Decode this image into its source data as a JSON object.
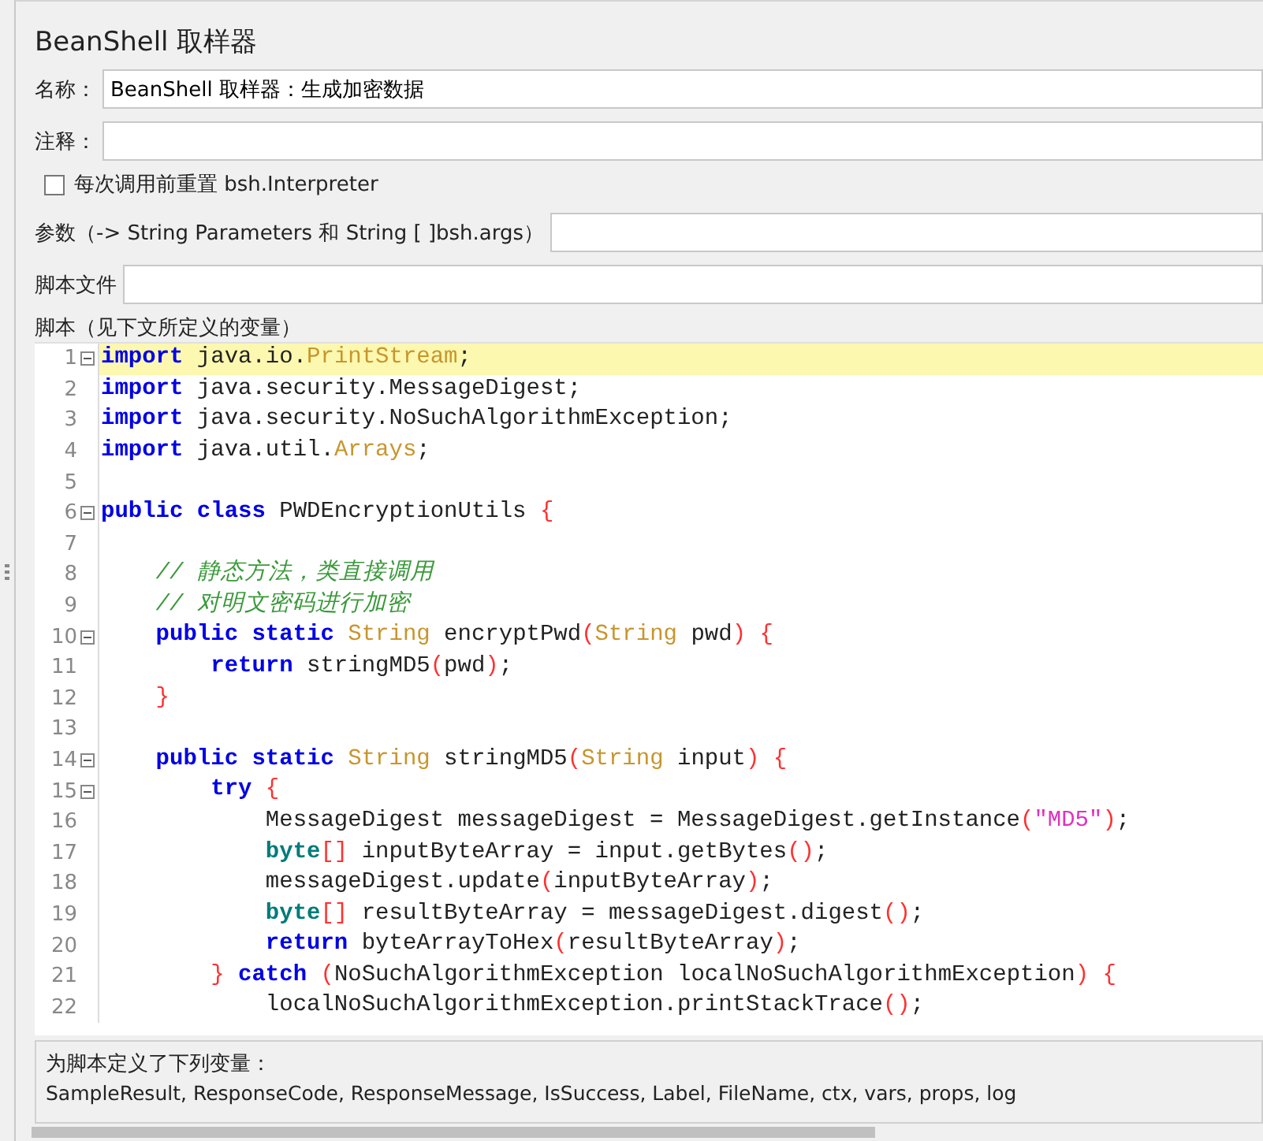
{
  "panel": {
    "title": "BeanShell 取样器"
  },
  "fields": [
    {
      "kind": "text",
      "label": "名称：",
      "value": "BeanShell 取样器：生成加密数据"
    },
    {
      "kind": "text",
      "label": "注释："
    },
    {
      "kind": "checkbox",
      "label": "每次调用前重置 bsh.Interpreter",
      "checked": false
    },
    {
      "kind": "text",
      "label": "参数（-> String Parameters 和 String [ ]bsh.args）"
    },
    {
      "kind": "text",
      "label": "脚本文件"
    }
  ],
  "script_label": "脚本（见下文所定义的变量）",
  "code": {
    "lines": [
      {
        "number": "1",
        "fold": true,
        "current": true,
        "tokens": [
          {
            "kind": "kw",
            "text": "import"
          },
          {
            "kind": "pl",
            "text": " java.io."
          },
          {
            "kind": "ty",
            "text": "PrintStream"
          },
          {
            "kind": "pl",
            "text": ";"
          }
        ]
      },
      {
        "number": "2",
        "fold": false,
        "current": false,
        "tokens": [
          {
            "kind": "kw",
            "text": "import"
          },
          {
            "kind": "pl",
            "text": " java.security.MessageDigest;"
          }
        ]
      },
      {
        "number": "3",
        "fold": false,
        "current": false,
        "tokens": [
          {
            "kind": "kw",
            "text": "import"
          },
          {
            "kind": "pl",
            "text": " java.security.NoSuchAlgorithmException;"
          }
        ]
      },
      {
        "number": "4",
        "fold": false,
        "current": false,
        "tokens": [
          {
            "kind": "kw",
            "text": "import"
          },
          {
            "kind": "pl",
            "text": " java.util."
          },
          {
            "kind": "ty",
            "text": "Arrays"
          },
          {
            "kind": "pl",
            "text": ";"
          }
        ]
      },
      {
        "number": "5",
        "fold": false,
        "current": false
      },
      {
        "number": "6",
        "fold": true,
        "current": false,
        "tokens": [
          {
            "kind": "kw",
            "text": "public class"
          },
          {
            "kind": "pl",
            "text": " PWDEncryptionUtils"
          },
          {
            "kind": "br",
            "text": " {"
          }
        ]
      },
      {
        "number": "7",
        "fold": false,
        "current": false
      },
      {
        "number": "8",
        "fold": false,
        "current": false,
        "tokens": [
          {
            "kind": "cm",
            "text": "    // 静态方法，类直接调用"
          }
        ]
      },
      {
        "number": "9",
        "fold": false,
        "current": false,
        "tokens": [
          {
            "kind": "cm",
            "text": "    // 对明文密码进行加密"
          }
        ]
      },
      {
        "number": "10",
        "fold": true,
        "current": false,
        "tokens": [
          {
            "kind": "kw",
            "text": "    public static"
          },
          {
            "kind": "ty",
            "text": " String"
          },
          {
            "kind": "pl",
            "text": " encryptPwd"
          },
          {
            "kind": "br",
            "text": "("
          },
          {
            "kind": "ty",
            "text": "String"
          },
          {
            "kind": "pl",
            "text": " pwd"
          },
          {
            "kind": "br",
            "text": ") {"
          }
        ]
      },
      {
        "number": "11",
        "fold": false,
        "current": false,
        "tokens": [
          {
            "kind": "kw",
            "text": "        return"
          },
          {
            "kind": "pl",
            "text": " stringMD5"
          },
          {
            "kind": "br",
            "text": "("
          },
          {
            "kind": "pl",
            "text": "pwd"
          },
          {
            "kind": "br",
            "text": ")"
          },
          {
            "kind": "pl",
            "text": ";"
          }
        ]
      },
      {
        "number": "12",
        "fold": false,
        "current": false,
        "tokens": [
          {
            "kind": "br",
            "text": "    }"
          }
        ]
      },
      {
        "number": "13",
        "fold": false,
        "current": false
      },
      {
        "number": "14",
        "fold": true,
        "current": false,
        "tokens": [
          {
            "kind": "kw",
            "text": "    public static"
          },
          {
            "kind": "ty",
            "text": " String"
          },
          {
            "kind": "pl",
            "text": " stringMD5"
          },
          {
            "kind": "br",
            "text": "("
          },
          {
            "kind": "ty",
            "text": "String"
          },
          {
            "kind": "pl",
            "text": " input"
          },
          {
            "kind": "br",
            "text": ") {"
          }
        ]
      },
      {
        "number": "15",
        "fold": true,
        "current": false,
        "tokens": [
          {
            "kind": "kw",
            "text": "        try"
          },
          {
            "kind": "br",
            "text": " {"
          }
        ]
      },
      {
        "number": "16",
        "fold": false,
        "current": false,
        "tokens": [
          {
            "kind": "pl",
            "text": "            MessageDigest messageDigest = MessageDigest.getInstance"
          },
          {
            "kind": "br",
            "text": "("
          },
          {
            "kind": "st",
            "text": "\"MD5\""
          },
          {
            "kind": "br",
            "text": ")"
          },
          {
            "kind": "pl",
            "text": ";"
          }
        ]
      },
      {
        "number": "17",
        "fold": false,
        "current": false,
        "tokens": [
          {
            "kind": "bt",
            "text": "            byte"
          },
          {
            "kind": "br",
            "text": "[]"
          },
          {
            "kind": "pl",
            "text": " inputByteArray = input.getBytes"
          },
          {
            "kind": "br",
            "text": "()"
          },
          {
            "kind": "pl",
            "text": ";"
          }
        ]
      },
      {
        "number": "18",
        "fold": false,
        "current": false,
        "tokens": [
          {
            "kind": "pl",
            "text": "            messageDigest.update"
          },
          {
            "kind": "br",
            "text": "("
          },
          {
            "kind": "pl",
            "text": "inputByteArray"
          },
          {
            "kind": "br",
            "text": ")"
          },
          {
            "kind": "pl",
            "text": ";"
          }
        ]
      },
      {
        "number": "19",
        "fold": false,
        "current": false,
        "tokens": [
          {
            "kind": "bt",
            "text": "            byte"
          },
          {
            "kind": "br",
            "text": "[]"
          },
          {
            "kind": "pl",
            "text": " resultByteArray = messageDigest.digest"
          },
          {
            "kind": "br",
            "text": "()"
          },
          {
            "kind": "pl",
            "text": ";"
          }
        ]
      },
      {
        "number": "20",
        "fold": false,
        "current": false,
        "tokens": [
          {
            "kind": "kw",
            "text": "            return"
          },
          {
            "kind": "pl",
            "text": " byteArrayToHex"
          },
          {
            "kind": "br",
            "text": "("
          },
          {
            "kind": "pl",
            "text": "resultByteArray"
          },
          {
            "kind": "br",
            "text": ")"
          },
          {
            "kind": "pl",
            "text": ";"
          }
        ]
      },
      {
        "number": "21",
        "fold": false,
        "current": false,
        "tokens": [
          {
            "kind": "br",
            "text": "        }"
          },
          {
            "kind": "kw",
            "text": " catch"
          },
          {
            "kind": "br",
            "text": " ("
          },
          {
            "kind": "pl",
            "text": "NoSuchAlgorithmException localNoSuchAlgorithmException"
          },
          {
            "kind": "br",
            "text": ") {"
          }
        ]
      },
      {
        "number": "22",
        "fold": false,
        "current": false,
        "tokens": [
          {
            "kind": "pl",
            "text": "            localNoSuchAlgorithmException.printStackTrace"
          },
          {
            "kind": "br",
            "text": "()"
          },
          {
            "kind": "pl",
            "text": ";"
          }
        ]
      }
    ]
  },
  "variables": {
    "heading": "为脚本定义了下列变量：",
    "list": "SampleResult, ResponseCode, ResponseMessage, IsSuccess, Label, FileName, ctx, vars, props, log"
  }
}
